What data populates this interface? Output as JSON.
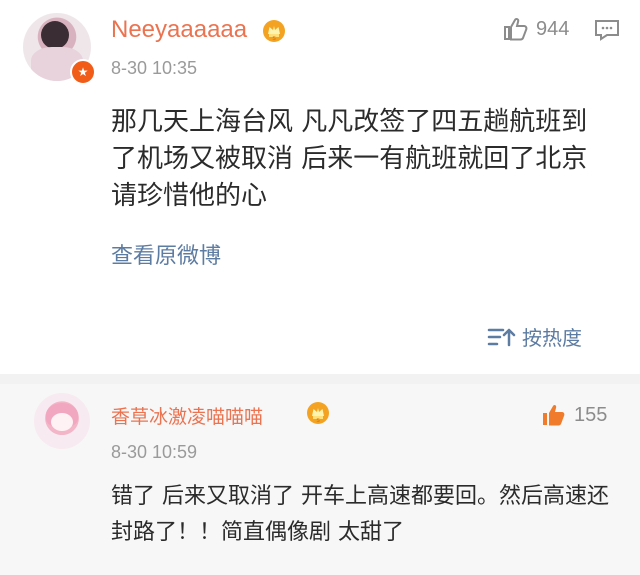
{
  "post": {
    "username": "Neeyaaaaaa",
    "timestamp": "8-30 10:35",
    "like_count": "944",
    "content": "那几天上海台风 凡凡改签了四五趟航班到了机场又被取消 后来一有航班就回了北京 请珍惜他的心",
    "view_original_link": "查看原微博"
  },
  "controls": {
    "sort_label": "按热度"
  },
  "reply": {
    "username": "香草冰激凌喵喵喵",
    "timestamp": "8-30 10:59",
    "like_count": "155",
    "content": "错了 后来又取消了 开车上高速都要回。然后高速还封路了！！简直偶像剧 太甜了"
  },
  "icons": {
    "post_avatar": "profile-photo",
    "vip_marker": "vip-icon",
    "member_badge": "crown-badge-icon",
    "post_like": "thumbs-up-icon",
    "comment": "comment-icon",
    "sort": "sort-icon",
    "reply_like": "thumbs-up-icon"
  },
  "colors": {
    "username": "#eb7350",
    "link": "#5d7ca2",
    "background": "#ffffff",
    "reply_background": "#f7f7f7"
  }
}
